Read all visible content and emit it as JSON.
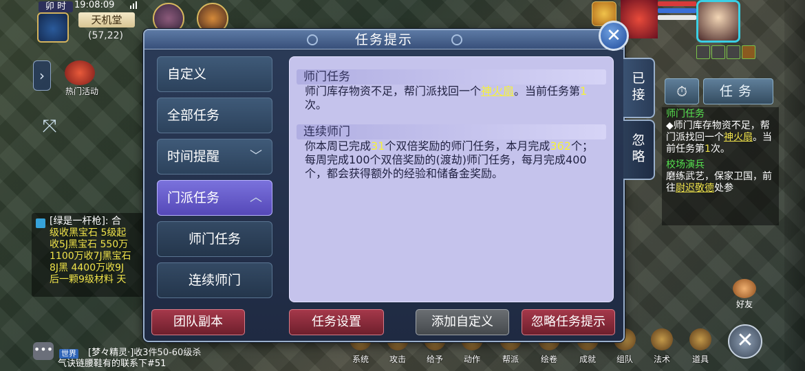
{
  "hud": {
    "time_tag": "卯 时",
    "clock": "19:08:09",
    "location": "天机堂",
    "coords": "(57,22)",
    "hot_event_label": "热门活动"
  },
  "chat": {
    "lines": [
      {
        "text": "[绿是一杆枪]: 合",
        "color": "#ffffff"
      },
      {
        "text": "级收黑宝石  5级起",
        "color": "#f0e34a"
      },
      {
        "text": "收5J黑宝石  550万",
        "color": "#f0e34a"
      },
      {
        "text": "1100万收7J黑宝石",
        "color": "#f0e34a"
      },
      {
        "text": "8J黑  4400万收9J",
        "color": "#f0e34a"
      },
      {
        "text": "后一颗9级材料  天",
        "color": "#f0e34a"
      }
    ],
    "bottom_tag": "世界",
    "bottom_msg1": "[梦々精灵·]收3件50-60级杀",
    "bottom_msg2": "气诀链腰鞋有的联系下#51"
  },
  "dialog": {
    "title": "任务提示",
    "categories": [
      {
        "label": "自定义",
        "arrow": ""
      },
      {
        "label": "全部任务",
        "arrow": ""
      },
      {
        "label": "时间提醒",
        "arrow": "﹀"
      },
      {
        "label": "门派任务",
        "arrow": "︿"
      },
      {
        "label": "师门任务",
        "arrow": ""
      },
      {
        "label": "连续师门",
        "arrow": ""
      }
    ],
    "sections": [
      {
        "head": "师门任务",
        "body_parts": [
          "师门库存物资不足，帮门派找回一个",
          "神火扇",
          "。当前任务第",
          "1",
          "次。"
        ]
      },
      {
        "head": "连续师门",
        "body_parts": [
          "你本周已完成",
          "31",
          "个双倍奖励的师门任务，本月完成",
          "362",
          "个；每周完成100个双倍奖励的(渡劫)师门任务，每月完成400个，都会获得额外的经验和储备金奖励。"
        ]
      }
    ],
    "side_tabs": [
      "已接",
      "忽略"
    ],
    "buttons": {
      "team_dungeon": "团队副本",
      "task_settings": "任务设置",
      "add_custom": "添加自定义",
      "ignore_tips": "忽略任务提示"
    },
    "close_symbol": "✕"
  },
  "tracker": {
    "timer_symbol": "⏱",
    "tab_label": "任务",
    "task1_title": "师门任务",
    "task1_parts": [
      "◆师门库存物资不足，帮门派找回一个",
      "神火扇",
      "。当前任务第",
      "1",
      "次。"
    ],
    "task2_title": "校场演兵",
    "task2_body": "磨练武艺，保家卫国，前往",
    "task2_link": "尉迟敬德",
    "task2_tail": "处参"
  },
  "bottom_bar": {
    "items": [
      "系统",
      "攻击",
      "给予",
      "动作",
      "帮派",
      "绘卷",
      "成就",
      "组队",
      "法术",
      "道具"
    ],
    "friends": "好友",
    "collapse": "✕"
  },
  "colors": {
    "highlight": "#f6f23a",
    "active_category": "#6a5fd0",
    "panel_bg": "#c5c3ec",
    "green_title": "#56e24f"
  }
}
